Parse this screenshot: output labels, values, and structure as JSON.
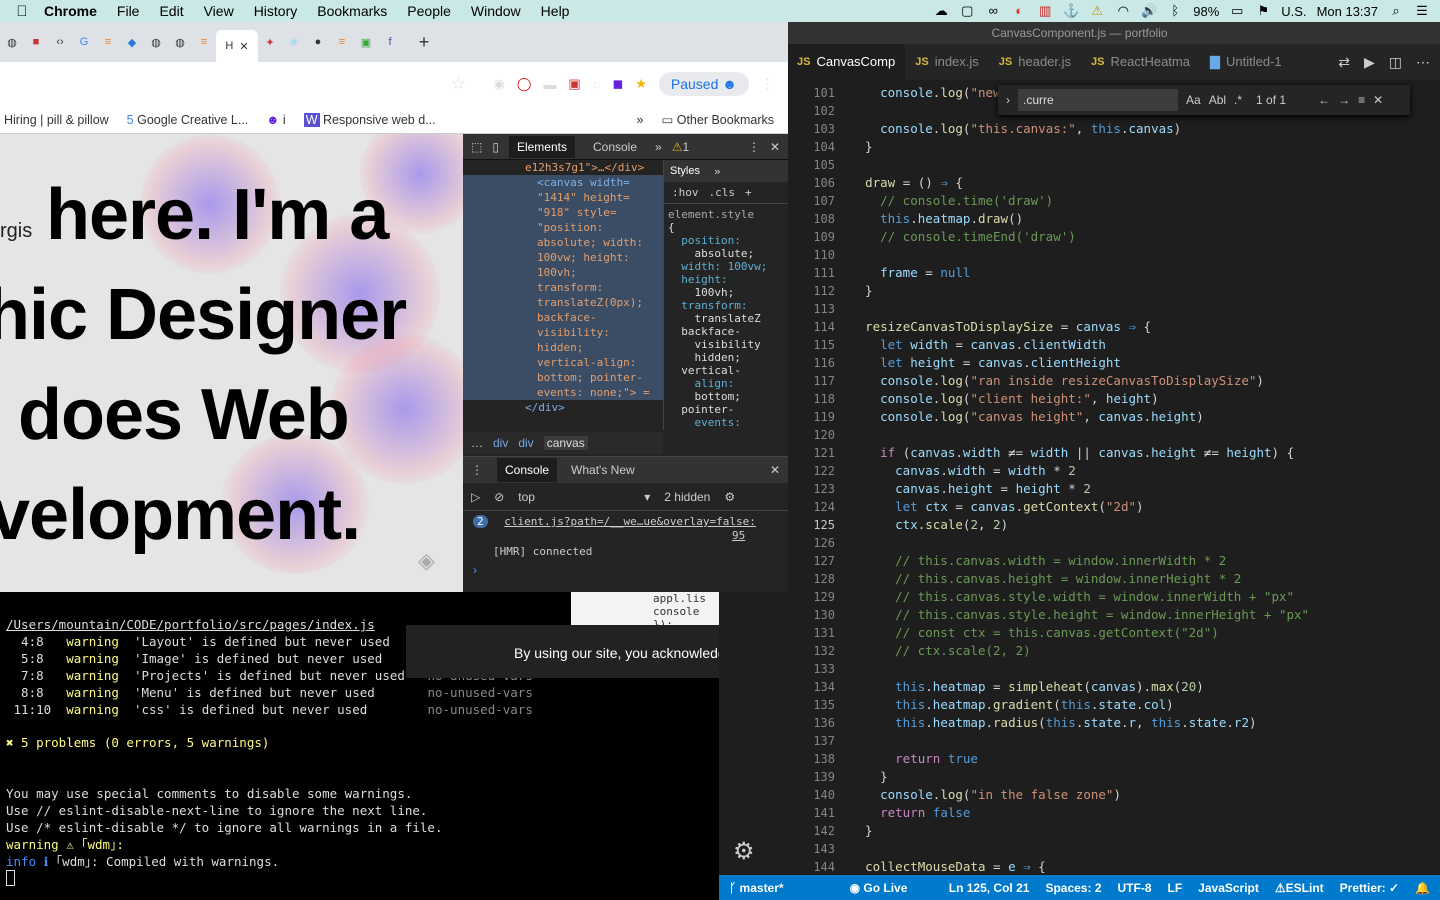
{
  "menubar": {
    "app": "Chrome",
    "items": [
      "File",
      "Edit",
      "View",
      "History",
      "Bookmarks",
      "People",
      "Window",
      "Help"
    ],
    "battery": "98%",
    "input_source": "U.S.",
    "clock": "Mon 13:37"
  },
  "vscode": {
    "window_title": "CanvasComponent.js — portfolio",
    "tabs": [
      {
        "label": "CanvasComp",
        "icon": "JS",
        "active": true
      },
      {
        "label": "index.js",
        "icon": "JS"
      },
      {
        "label": "header.js",
        "icon": "JS"
      },
      {
        "label": "ReactHeatma",
        "icon": "JS"
      },
      {
        "label": "Untitled-1",
        "icon": "file"
      }
    ],
    "find": {
      "query": ".curre",
      "count": "1 of 1",
      "case_label": "Aa",
      "word_label": "Abl"
    },
    "current_line": "125",
    "lines": [
      {
        "n": "101",
        "html": "    <span class='v'>console</span>.<span class='f'>log</span>(<span class='s'>\"newWi</span>"
      },
      {
        "n": "102",
        "html": ""
      },
      {
        "n": "103",
        "html": "    <span class='v'>console</span>.<span class='f'>log</span>(<span class='s'>\"this.canvas:\"</span>, <span class='k'>this</span>.<span class='v'>canvas</span>)"
      },
      {
        "n": "104",
        "html": "  }"
      },
      {
        "n": "105",
        "html": ""
      },
      {
        "n": "106",
        "html": "  <span class='f'>draw</span> = () <span class='k'>⇒</span> {"
      },
      {
        "n": "107",
        "html": "    <span class='c'>// console.time('draw')</span>"
      },
      {
        "n": "108",
        "html": "    <span class='k'>this</span>.<span class='v'>heatmap</span>.<span class='f'>draw</span>()"
      },
      {
        "n": "109",
        "html": "    <span class='c'>// console.timeEnd('draw')</span>"
      },
      {
        "n": "110",
        "html": ""
      },
      {
        "n": "111",
        "html": "    <span class='v'>frame</span> = <span class='k'>null</span>"
      },
      {
        "n": "112",
        "html": "  }"
      },
      {
        "n": "113",
        "html": ""
      },
      {
        "n": "114",
        "html": "  <span class='f'>resizeCanvasToDisplaySize</span> = <span class='v'>canvas</span> <span class='k'>⇒</span> {"
      },
      {
        "n": "115",
        "html": "    <span class='k'>let</span> <span class='v'>width</span> = <span class='v'>canvas</span>.<span class='v'>clientWidth</span>"
      },
      {
        "n": "116",
        "html": "    <span class='k'>let</span> <span class='v'>height</span> = <span class='v'>canvas</span>.<span class='v'>clientHeight</span>"
      },
      {
        "n": "117",
        "html": "    <span class='v'>console</span>.<span class='f'>log</span>(<span class='s'>\"ran inside resizeCanvasToDisplaySize\"</span>)"
      },
      {
        "n": "118",
        "html": "    <span class='v'>console</span>.<span class='f'>log</span>(<span class='s'>\"client height:\"</span>, <span class='v'>height</span>)"
      },
      {
        "n": "119",
        "html": "    <span class='v'>console</span>.<span class='f'>log</span>(<span class='s'>\"canvas height\"</span>, <span class='v'>canvas</span>.<span class='v'>height</span>)"
      },
      {
        "n": "120",
        "html": ""
      },
      {
        "n": "121",
        "html": "    <span class='kw'>if</span> (<span class='v'>canvas</span>.<span class='v'>width</span> ≠= <span class='v'>width</span> || <span class='v'>canvas</span>.<span class='v'>height</span> ≠= <span class='v'>height</span>) {"
      },
      {
        "n": "122",
        "html": "      <span class='v'>canvas</span>.<span class='v'>width</span> = <span class='v'>width</span> * <span class='n'>2</span>"
      },
      {
        "n": "123",
        "html": "      <span class='v'>canvas</span>.<span class='v'>height</span> = <span class='v'>height</span> * <span class='n'>2</span>"
      },
      {
        "n": "124",
        "html": "      <span class='k'>let</span> <span class='v'>ctx</span> = <span class='v'>canvas</span>.<span class='f'>getContext</span>(<span class='s'>\"2d\"</span>)"
      },
      {
        "n": "125",
        "html": "      <span class='v'>ctx</span>.<span class='f'>scale</span>(<span class='n'>2</span>, <span class='n'>2</span>)"
      },
      {
        "n": "126",
        "html": ""
      },
      {
        "n": "127",
        "html": "      <span class='c'>// this.canvas.width = window.innerWidth * 2</span>"
      },
      {
        "n": "128",
        "html": "      <span class='c'>// this.canvas.height = window.innerHeight * 2</span>"
      },
      {
        "n": "129",
        "html": "      <span class='c'>// this.canvas.style.width = window.innerWidth + \"px\"</span>"
      },
      {
        "n": "130",
        "html": "      <span class='c'>// this.canvas.style.height = window.innerHeight + \"px\"</span>"
      },
      {
        "n": "131",
        "html": "      <span class='c'>// const ctx = this.canvas.getContext(\"2d\")</span>"
      },
      {
        "n": "132",
        "html": "      <span class='c'>// ctx.scale(2, 2)</span>"
      },
      {
        "n": "133",
        "html": ""
      },
      {
        "n": "134",
        "html": "      <span class='k'>this</span>.<span class='v'>heatmap</span> = <span class='f'>simpleheat</span>(<span class='v'>canvas</span>).<span class='f'>max</span>(<span class='n'>20</span>)"
      },
      {
        "n": "135",
        "html": "      <span class='k'>this</span>.<span class='v'>heatmap</span>.<span class='f'>gradient</span>(<span class='k'>this</span>.<span class='v'>state</span>.<span class='v'>col</span>)"
      },
      {
        "n": "136",
        "html": "      <span class='k'>this</span>.<span class='v'>heatmap</span>.<span class='f'>radius</span>(<span class='k'>this</span>.<span class='v'>state</span>.<span class='v'>r</span>, <span class='k'>this</span>.<span class='v'>state</span>.<span class='v'>r2</span>)"
      },
      {
        "n": "137",
        "html": ""
      },
      {
        "n": "138",
        "html": "      <span class='kw'>return</span> <span class='k'>true</span>"
      },
      {
        "n": "139",
        "html": "    }"
      },
      {
        "n": "140",
        "html": "    <span class='v'>console</span>.<span class='f'>log</span>(<span class='s'>\"in the false zone\"</span>)"
      },
      {
        "n": "141",
        "html": "    <span class='kw'>return</span> <span class='k'>false</span>"
      },
      {
        "n": "142",
        "html": "  }"
      },
      {
        "n": "143",
        "html": ""
      },
      {
        "n": "144",
        "html": "  <span class='f'>collectMouseData</span> = <span class='v'>e</span> <span class='k'>⇒</span> {"
      }
    ],
    "status": {
      "branch": "master*",
      "live": "Go Live",
      "position": "Ln 125, Col 21",
      "spaces": "Spaces: 2",
      "encoding": "UTF-8",
      "eol": "LF",
      "language": "JavaScript",
      "eslint": "ESLint",
      "prettier": "Prettier: ✓"
    }
  },
  "chrome": {
    "paused": "Paused",
    "bookmarks": [
      "Hiring | pill & pillow",
      "Google Creative L...",
      "i",
      "Responsive web d..."
    ],
    "other_bookmarks": "Other Bookmarks",
    "page": {
      "name_fragment": "rgis",
      "line1": "here. I'm a",
      "line2": "hic Designer",
      "line3": "does Web",
      "line4": "velopment."
    },
    "devtools": {
      "tabs": [
        "Elements",
        "Console"
      ],
      "warn_count": "1",
      "elements_lines": [
        "e12h3s7g1\">…</div>",
        "<canvas width=",
        "\"1414\" height=",
        "\"918\" style=",
        "\"position:",
        "absolute; width:",
        "100vw; height:",
        "100vh;",
        "transform:",
        "translateZ(0px);",
        "backface-",
        "visibility:",
        "hidden;",
        "vertical-align:",
        "bottom; pointer-",
        "events: none;\"> =",
        "</div>"
      ],
      "styles_tab": "Styles",
      "hov": ":hov",
      "cls": ".cls",
      "styles_lines": [
        "element.style",
        "{",
        "  position:",
        "    absolute;",
        "  width: 100vw;",
        "  height:",
        "    100vh;",
        "  transform:",
        "    translateZ",
        "  backface-",
        "    visibility",
        "    hidden;",
        "  vertical-",
        "    align:",
        "    bottom;",
        "  pointer-",
        "    events:",
        "    none;"
      ],
      "crumbs": [
        "div",
        "div",
        "canvas"
      ],
      "console_tabs": [
        "Console",
        "What's New"
      ],
      "context": "top",
      "hidden": "2 hidden",
      "log_count": "2",
      "log_link": "client.js?path=/__we…ue&overlay=false:",
      "log_line": "95",
      "log_msg": "[HMR] connected"
    }
  },
  "terminal": {
    "path": "/Users/mountain/CODE/portfolio/src/pages/index.js",
    "warnings": [
      {
        "loc": "  4:8 ",
        "level": "warning",
        "msg": "'Layout' is defined but never used   ",
        "rule": "no-unused-vars"
      },
      {
        "loc": "  5:8 ",
        "level": "warning",
        "msg": "'Image' is defined but never used    ",
        "rule": "no-unused-vars"
      },
      {
        "loc": "  7:8 ",
        "level": "warning",
        "msg": "'Projects' is defined but never used ",
        "rule": "no-unused-vars"
      },
      {
        "loc": "  8:8 ",
        "level": "warning",
        "msg": "'Menu' is defined but never used     ",
        "rule": "no-unused-vars"
      },
      {
        "loc": " 11:10",
        "level": "warning",
        "msg": "'css' is defined but never used      ",
        "rule": "no-unused-vars"
      }
    ],
    "summary": "✖ 5 problems (0 errors, 5 warnings)",
    "help1": "You may use special comments to disable some warnings.",
    "help2": "Use // eslint-disable-next-line to ignore the next line.",
    "help3": "Use /* eslint-disable */ to ignore all warnings in a file.",
    "warn_line": "warning ⚠ ｢wdm｣:",
    "info_label": "info ℹ",
    "info_line": " ｢wdm｣: Compiled with warnings.",
    "cookie": "By using our site, you acknowledge",
    "behind_code": [
      "appl.lis",
      "  console",
      "});"
    ]
  }
}
